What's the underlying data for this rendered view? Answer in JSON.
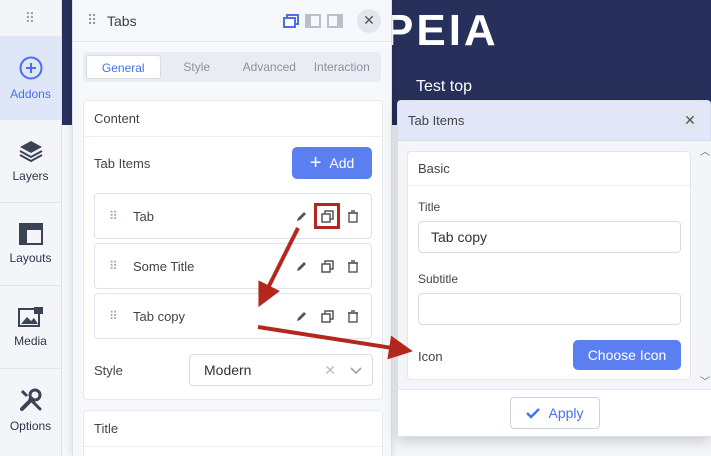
{
  "site": {
    "logo": "PEIA",
    "text": "Test top"
  },
  "sidebar": {
    "items": [
      {
        "label": "Addons",
        "icon": "plus-circle-icon"
      },
      {
        "label": "Layers",
        "icon": "layers-icon"
      },
      {
        "label": "Layouts",
        "icon": "layout-icon"
      },
      {
        "label": "Media",
        "icon": "media-icon"
      },
      {
        "label": "Options",
        "icon": "wrench-icon"
      }
    ]
  },
  "panel": {
    "title": "Tabs",
    "tabs": [
      "General",
      "Style",
      "Advanced",
      "Interaction"
    ],
    "content_title": "Content",
    "tab_items_label": "Tab Items",
    "add_label": "Add",
    "items": [
      "Tab",
      "Some Title",
      "Tab copy"
    ],
    "style_label": "Style",
    "style_value": "Modern",
    "title_section": "Title"
  },
  "modal": {
    "title": "Tab Items",
    "section": "Basic",
    "title_label": "Title",
    "title_value": "Tab copy",
    "subtitle_label": "Subtitle",
    "subtitle_value": "",
    "icon_label": "Icon",
    "choose_icon": "Choose Icon",
    "apply": "Apply"
  },
  "colors": {
    "accent": "#5b7ff0",
    "highlight": "#b3271e",
    "hero": "#26305a"
  }
}
